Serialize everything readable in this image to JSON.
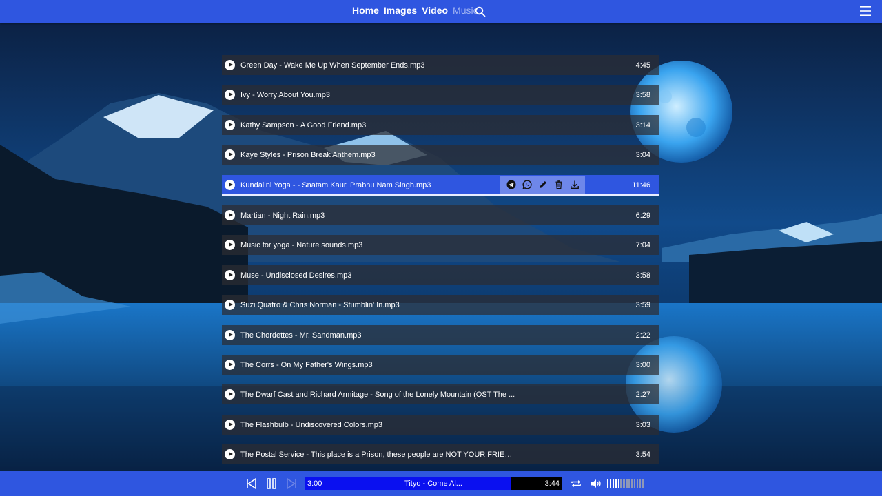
{
  "nav": {
    "items": [
      {
        "label": "Home",
        "active": false
      },
      {
        "label": "Images",
        "active": false
      },
      {
        "label": "Video",
        "active": false
      },
      {
        "label": "Music",
        "active": true
      }
    ],
    "search_icon": "search-icon",
    "menu_icon": "hamburger-menu-icon"
  },
  "playlist": {
    "tracks": [
      {
        "title": "Green Day - Wake Me Up When September Ends.mp3",
        "duration": "4:45"
      },
      {
        "title": "Ivy - Worry About You.mp3",
        "duration": "3:58"
      },
      {
        "title": "Kathy Sampson - A Good Friend.mp3",
        "duration": "3:14"
      },
      {
        "title": "Kaye Styles - Prison Break Anthem.mp3",
        "duration": "3:04"
      },
      {
        "title": "Kundalini Yoga - - Snatam Kaur, Prabhu Nam Singh.mp3",
        "duration": "11:46"
      },
      {
        "title": "Martian - Night Rain.mp3",
        "duration": "6:29"
      },
      {
        "title": "Music for yoga - Nature sounds.mp3",
        "duration": "7:04"
      },
      {
        "title": "Muse - Undisclosed Desires.mp3",
        "duration": "3:58"
      },
      {
        "title": "Suzi Quatro & Chris Norman - Stumblin' In.mp3",
        "duration": "3:59"
      },
      {
        "title": "The Chordettes - Mr. Sandman.mp3",
        "duration": "2:22"
      },
      {
        "title": "The Corrs - On My Father's Wings.mp3",
        "duration": "3:00"
      },
      {
        "title": "The Dwarf Cast and Richard Armitage - Song of the Lonely Mountain (OST The ...",
        "duration": "2:27"
      },
      {
        "title": "The Flashbulb - Undiscovered Colors.mp3",
        "duration": "3:03"
      },
      {
        "title": "The Postal Service - This place is a Prison, these people are NOT YOUR FRIENDS...",
        "duration": "3:54"
      }
    ],
    "active_index": 4,
    "row_actions": [
      "telegram-icon",
      "viber-icon",
      "edit-pencil-icon",
      "trash-icon",
      "download-icon"
    ]
  },
  "player": {
    "current_time": "3:00",
    "track_name": "Tityo - Come Al...",
    "total_time": "3:44",
    "progress_fraction": 0.8,
    "volume_fraction": 0.36,
    "icons": [
      "previous-icon",
      "pause-icon",
      "next-icon",
      "repeat-icon",
      "volume-icon"
    ]
  },
  "colors": {
    "accent": "#2f56e0",
    "row_bg": "#2d2d32",
    "progress_fill": "#0a10f0",
    "action_bar": "#6e87ea"
  }
}
